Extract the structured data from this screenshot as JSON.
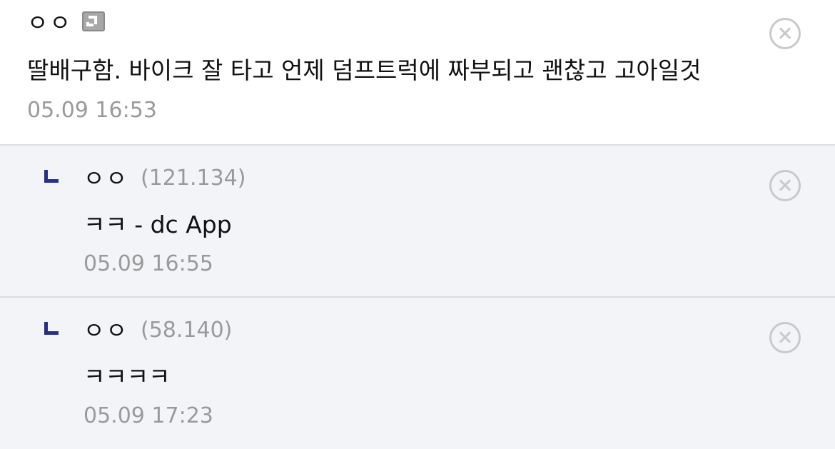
{
  "main_comment": {
    "author": "ㅇㅇ",
    "nick_icon": "fixed-nick-icon",
    "body": "딸배구함. 바이크 잘 타고 언제 덤프트럭에 짜부되고 괜찮고 고아일것",
    "date": "05.09 16:53",
    "delete_icon": "close-circle-icon"
  },
  "replies": [
    {
      "marker": "ㄴ",
      "author": "ㅇㅇ",
      "ip": "(121.134)",
      "body": "ㅋㅋ - dc App",
      "date": "05.09 16:55",
      "delete_icon": "close-circle-icon"
    },
    {
      "marker": "ㄴ",
      "author": "ㅇㅇ",
      "ip": "(58.140)",
      "body": "ㅋㅋㅋㅋ",
      "date": "05.09 17:23",
      "delete_icon": "close-circle-icon"
    }
  ],
  "colors": {
    "reply_background": "#f3f4f8",
    "reply_marker": "#2b2f84",
    "meta_text": "#9a9a9a",
    "divider": "#dcdde2"
  }
}
